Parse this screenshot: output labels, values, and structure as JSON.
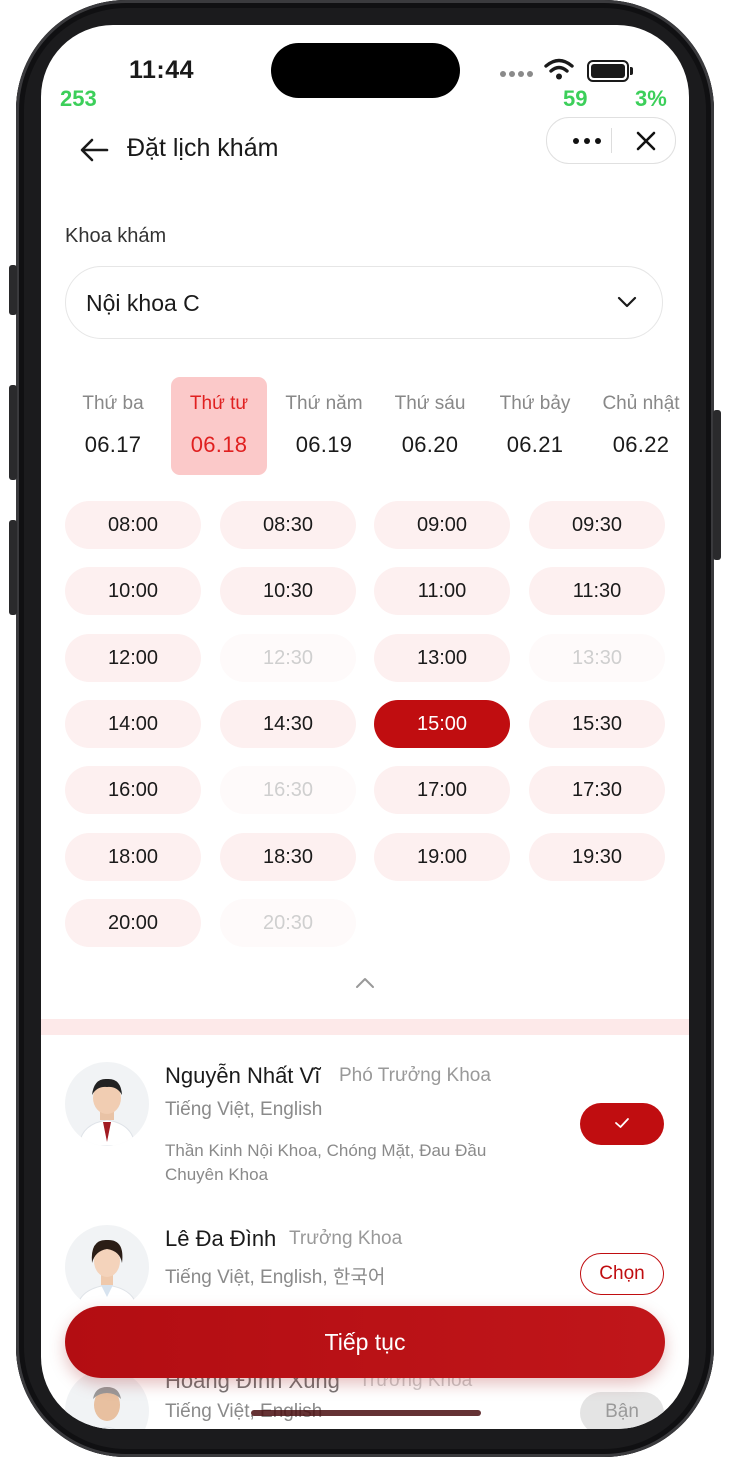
{
  "status": {
    "time": "11:44",
    "fps_left": "253",
    "fps_mid": "59",
    "fps_right": "3%"
  },
  "header": {
    "title": "Đặt lịch khám"
  },
  "dept": {
    "label": "Khoa khám",
    "value": "Nội khoa C"
  },
  "days": [
    {
      "name": "Thứ ba",
      "date": "06.17",
      "selected": false
    },
    {
      "name": "Thứ tư",
      "date": "06.18",
      "selected": true
    },
    {
      "name": "Thứ năm",
      "date": "06.19",
      "selected": false
    },
    {
      "name": "Thứ sáu",
      "date": "06.20",
      "selected": false
    },
    {
      "name": "Thứ bảy",
      "date": "06.21",
      "selected": false
    },
    {
      "name": "Chủ nhật",
      "date": "06.22",
      "selected": false
    }
  ],
  "slots": [
    {
      "time": "08:00",
      "state": "available"
    },
    {
      "time": "08:30",
      "state": "available"
    },
    {
      "time": "09:00",
      "state": "available"
    },
    {
      "time": "09:30",
      "state": "available"
    },
    {
      "time": "10:00",
      "state": "available"
    },
    {
      "time": "10:30",
      "state": "available"
    },
    {
      "time": "11:00",
      "state": "available"
    },
    {
      "time": "11:30",
      "state": "available"
    },
    {
      "time": "12:00",
      "state": "available"
    },
    {
      "time": "12:30",
      "state": "disabled"
    },
    {
      "time": "13:00",
      "state": "available"
    },
    {
      "time": "13:30",
      "state": "disabled"
    },
    {
      "time": "14:00",
      "state": "available"
    },
    {
      "time": "14:30",
      "state": "available"
    },
    {
      "time": "15:00",
      "state": "selected"
    },
    {
      "time": "15:30",
      "state": "available"
    },
    {
      "time": "16:00",
      "state": "available"
    },
    {
      "time": "16:30",
      "state": "disabled"
    },
    {
      "time": "17:00",
      "state": "available"
    },
    {
      "time": "17:30",
      "state": "available"
    },
    {
      "time": "18:00",
      "state": "available"
    },
    {
      "time": "18:30",
      "state": "available"
    },
    {
      "time": "19:00",
      "state": "available"
    },
    {
      "time": "19:30",
      "state": "available"
    },
    {
      "time": "20:00",
      "state": "available"
    },
    {
      "time": "20:30",
      "state": "disabled"
    }
  ],
  "doctors": [
    {
      "name": "Nguyễn Nhất Vĩ",
      "title": "Phó Trưởng Khoa",
      "languages": "Tiếng Việt, English",
      "specialty": "Thần Kinh Nội Khoa, Chóng Mặt, Đau Đầu Chuyên Khoa",
      "action": "selected",
      "action_label": ""
    },
    {
      "name": "Lê Đa Đình",
      "title": "Trưởng Khoa",
      "languages": "Tiếng Việt, English, 한국어",
      "specialty": "",
      "action": "choose",
      "action_label": "Chọn"
    },
    {
      "name": "Hoàng Đình Xung",
      "title": "Trưởng Khoa",
      "languages": "Tiếng Việt, English",
      "specialty": "",
      "action": "busy",
      "action_label": "Bận"
    }
  ],
  "footer": {
    "continue_label": "Tiếp tục"
  },
  "colors": {
    "accent": "#c00d10",
    "slot_bg": "#fdf0f0",
    "day_selected_bg": "#fbc9c9",
    "fps_green": "#3ccf5a"
  }
}
